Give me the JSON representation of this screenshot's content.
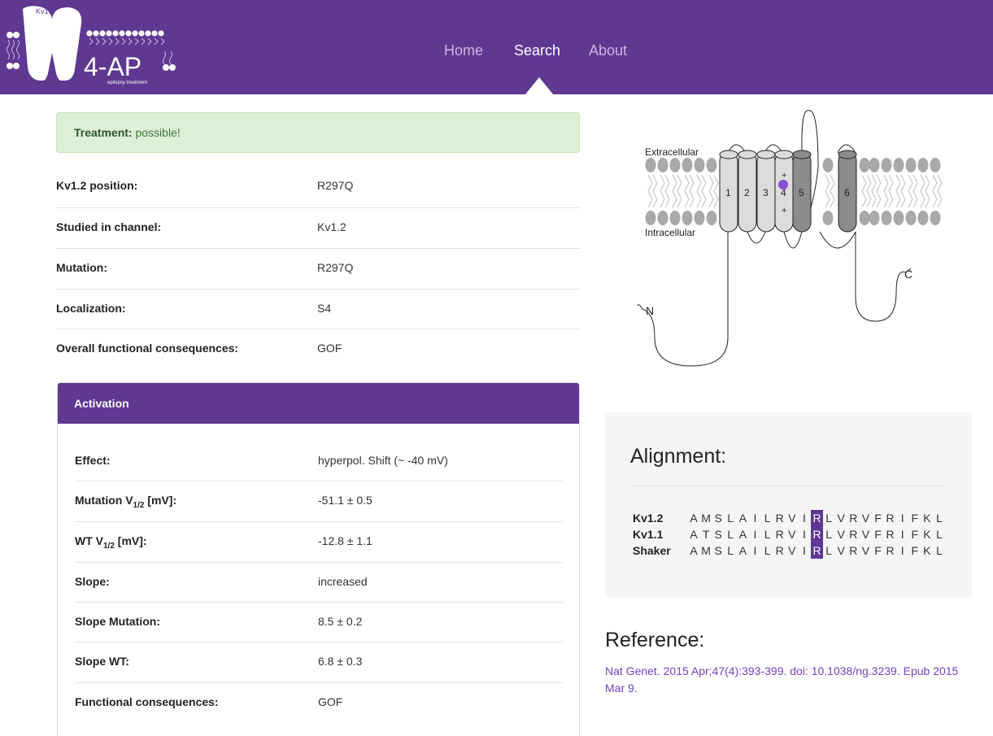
{
  "brand": {
    "logo_superscript": "Kv1.2",
    "logo_title": "4-AP",
    "logo_subtitle": "epilepsy treatment"
  },
  "nav": {
    "items": [
      {
        "label": "Home",
        "active": false
      },
      {
        "label": "Search",
        "active": true
      },
      {
        "label": "About",
        "active": false
      }
    ]
  },
  "alert": {
    "label": "Treatment:",
    "value": "possible!"
  },
  "info": {
    "rows": [
      {
        "label": "Kv1.2 position:",
        "value": "R297Q"
      },
      {
        "label": "Studied in channel:",
        "value": "Kv1.2"
      },
      {
        "label": "Mutation:",
        "value": "R297Q"
      },
      {
        "label": "Localization:",
        "value": "S4"
      },
      {
        "label": "Overall functional consequences:",
        "value": "GOF"
      }
    ]
  },
  "activation": {
    "title": "Activation",
    "rows": [
      {
        "label": "Effect:",
        "value": "hyperpol. Shift (~ -40 mV)"
      },
      {
        "label_main": "Mutation V",
        "label_sub": "1/2",
        "label_tail": " [mV]:",
        "value": "-51.1 ± 0.5"
      },
      {
        "label_main": "WT V",
        "label_sub": "1/2",
        "label_tail": " [mV]:",
        "value": "-12.8 ± 1.1"
      },
      {
        "label": "Slope:",
        "value": "increased"
      },
      {
        "label": "Slope Mutation:",
        "value": "8.5 ± 0.2"
      },
      {
        "label": "Slope WT:",
        "value": "6.8 ± 0.3"
      },
      {
        "label": "Functional consequences:",
        "value": "GOF"
      }
    ]
  },
  "diagram": {
    "extracellular_label": "Extracellular",
    "intracellular_label": "Intracellular",
    "segments": [
      "1",
      "2",
      "3",
      "4",
      "5",
      "6"
    ],
    "n_terminus": "N",
    "c_terminus": "C",
    "charge_plus": "+",
    "mutation_marker_color": "#8a4fd0"
  },
  "alignment": {
    "title": "Alignment:",
    "highlight_index": 10,
    "highlight_color": "#5e3891",
    "sequences": [
      {
        "name": "Kv1.2",
        "residues": [
          "A",
          "M",
          "S",
          "L",
          "A",
          "I",
          "L",
          "R",
          "V",
          "I",
          "R",
          "L",
          "V",
          "R",
          "V",
          "F",
          "R",
          "I",
          "F",
          "K",
          "L"
        ]
      },
      {
        "name": "Kv1.1",
        "residues": [
          "A",
          "T",
          "S",
          "L",
          "A",
          "I",
          "L",
          "R",
          "V",
          "I",
          "R",
          "L",
          "V",
          "R",
          "V",
          "F",
          "R",
          "I",
          "F",
          "K",
          "L"
        ]
      },
      {
        "name": "Shaker",
        "residues": [
          "A",
          "M",
          "S",
          "L",
          "A",
          "I",
          "L",
          "R",
          "V",
          "I",
          "R",
          "L",
          "V",
          "R",
          "V",
          "F",
          "R",
          "I",
          "F",
          "K",
          "L"
        ]
      }
    ]
  },
  "reference": {
    "title": "Reference:",
    "citation": "Nat Genet. 2015 Apr;47(4):393-399. doi: 10.1038/ng.3239. Epub 2015 Mar 9."
  },
  "colors": {
    "brand_purple": "#5e3891",
    "alert_bg": "#dff0d8",
    "link": "#6f42c1"
  }
}
